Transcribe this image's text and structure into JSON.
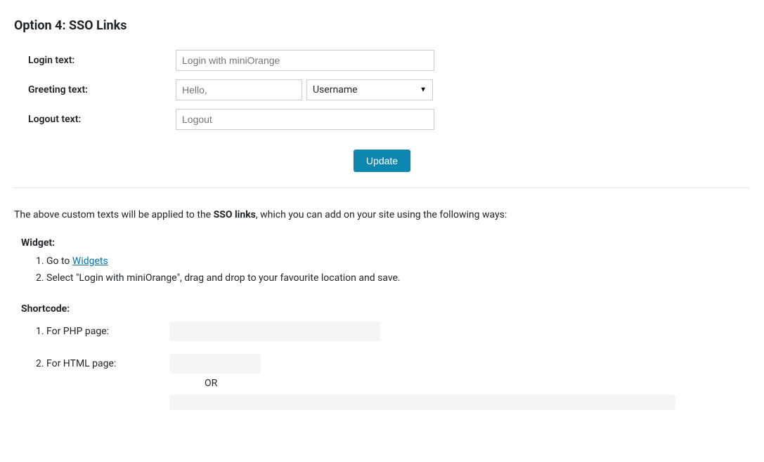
{
  "title": "Option 4: SSO Links",
  "form": {
    "login_label": "Login text:",
    "login_placeholder": "Login with miniOrange",
    "greeting_label": "Greeting text:",
    "greeting_placeholder": "Hello,",
    "greeting_select": "Username",
    "logout_label": "Logout text:",
    "logout_placeholder": "Logout",
    "update_button": "Update"
  },
  "desc": {
    "prefix": "The above custom texts will be applied to the ",
    "bold": "SSO links",
    "suffix": ", which you can add on your site using the following ways:"
  },
  "widget": {
    "heading": "Widget:",
    "step1_prefix": "Go to ",
    "step1_link": "Widgets",
    "step2": "Select \"Login with miniOrange\", drag and drop to your favourite location and save."
  },
  "shortcode": {
    "heading": "Shortcode:",
    "php_label": "For PHP page:",
    "html_label": "For HTML page:",
    "or": "OR"
  }
}
